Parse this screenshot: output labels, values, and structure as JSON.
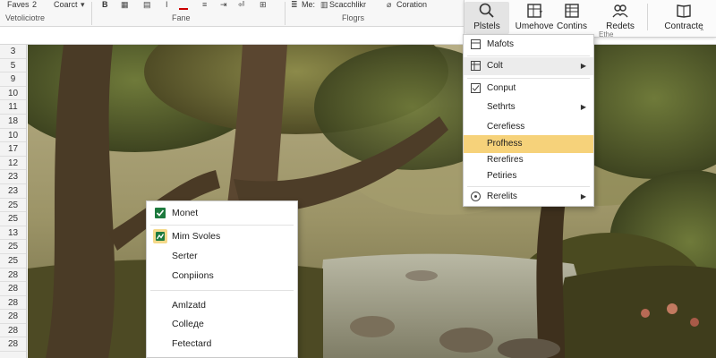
{
  "ribbon": {
    "top_labels": [
      "Faves",
      "2",
      "Coarct",
      "B",
      "Me:",
      "Scacchlikr",
      "Coration"
    ],
    "groups": [
      "Vetoliciotre",
      "Fane",
      "Flogrs"
    ]
  },
  "ribbon_panel": {
    "buttons": [
      {
        "label": "Plstels",
        "icon": "search-icon",
        "active": true
      },
      {
        "label": "Umehove",
        "icon": "table-icon",
        "has_dropdown": true
      },
      {
        "label": "Contins",
        "icon": "table-grid-icon"
      },
      {
        "label": "Redets",
        "icon": "users-icon"
      },
      {
        "label": "Contracte",
        "icon": "book-icon"
      }
    ],
    "group_label": "Ethe"
  },
  "row_numbers": [
    "3",
    "5",
    "9",
    "10",
    "11",
    "18",
    "10",
    "17",
    "12",
    "23",
    "23",
    "25",
    "25",
    "13",
    "25",
    "25",
    "28",
    "28",
    "28",
    "28",
    "28",
    "28"
  ],
  "right_menu": {
    "items": [
      {
        "label": "Mafots",
        "icon": "table-icon"
      },
      {
        "label": "Colt",
        "icon": "table-grid-icon",
        "submenu": true,
        "state": "hover"
      },
      {
        "label": "Conput",
        "icon": "check-box-icon"
      },
      {
        "label": "Sethrts",
        "submenu": true
      },
      {
        "label": "Cerefiess"
      },
      {
        "label": "Profhess",
        "state": "highlighted"
      },
      {
        "label": "Rerefires"
      },
      {
        "label": "Petiries"
      },
      {
        "label": "Rerelits",
        "icon": "help-circle-icon",
        "submenu": true
      }
    ]
  },
  "left_menu": {
    "items": [
      {
        "label": "Monet",
        "icon": "check-green-icon"
      },
      {
        "label": "Mim Svoles",
        "icon": "chart-green-icon",
        "state": "highlighted"
      },
      {
        "label": "Serter"
      },
      {
        "label": "Conpiions"
      },
      {
        "label": "Amlzatd"
      },
      {
        "label": "Colleде"
      },
      {
        "label": "Fetectard"
      }
    ]
  },
  "colors": {
    "highlight": "#f6d27a",
    "hover": "#ececec",
    "excel_green": "#1d7a3e"
  }
}
